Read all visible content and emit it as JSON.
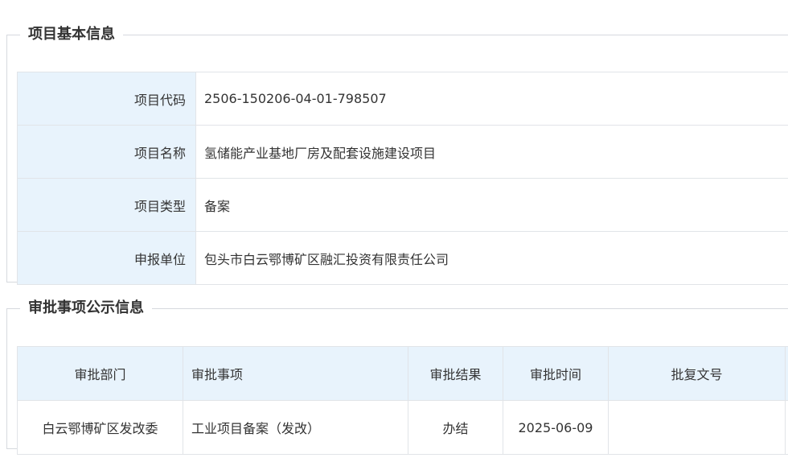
{
  "basic_info": {
    "title": "项目基本信息",
    "rows": [
      {
        "label": "项目代码",
        "value": "2506-150206-04-01-798507"
      },
      {
        "label": "项目名称",
        "value": "氢储能产业基地厂房及配套设施建设项目"
      },
      {
        "label": "项目类型",
        "value": "备案"
      },
      {
        "label": "申报单位",
        "value": "包头市白云鄂博矿区融汇投资有限责任公司"
      }
    ]
  },
  "approval_info": {
    "title": "审批事项公示信息",
    "headers": [
      "审批部门",
      "审批事项",
      "审批结果",
      "审批时间",
      "批复文号"
    ],
    "rows": [
      [
        "白云鄂博矿区发改委",
        "工业项目备案（发改）",
        "办结",
        "2025-06-09",
        ""
      ]
    ]
  },
  "colors": {
    "label_bg": "#e8f3fc",
    "border": "#e1e4e8",
    "text": "#333333"
  }
}
